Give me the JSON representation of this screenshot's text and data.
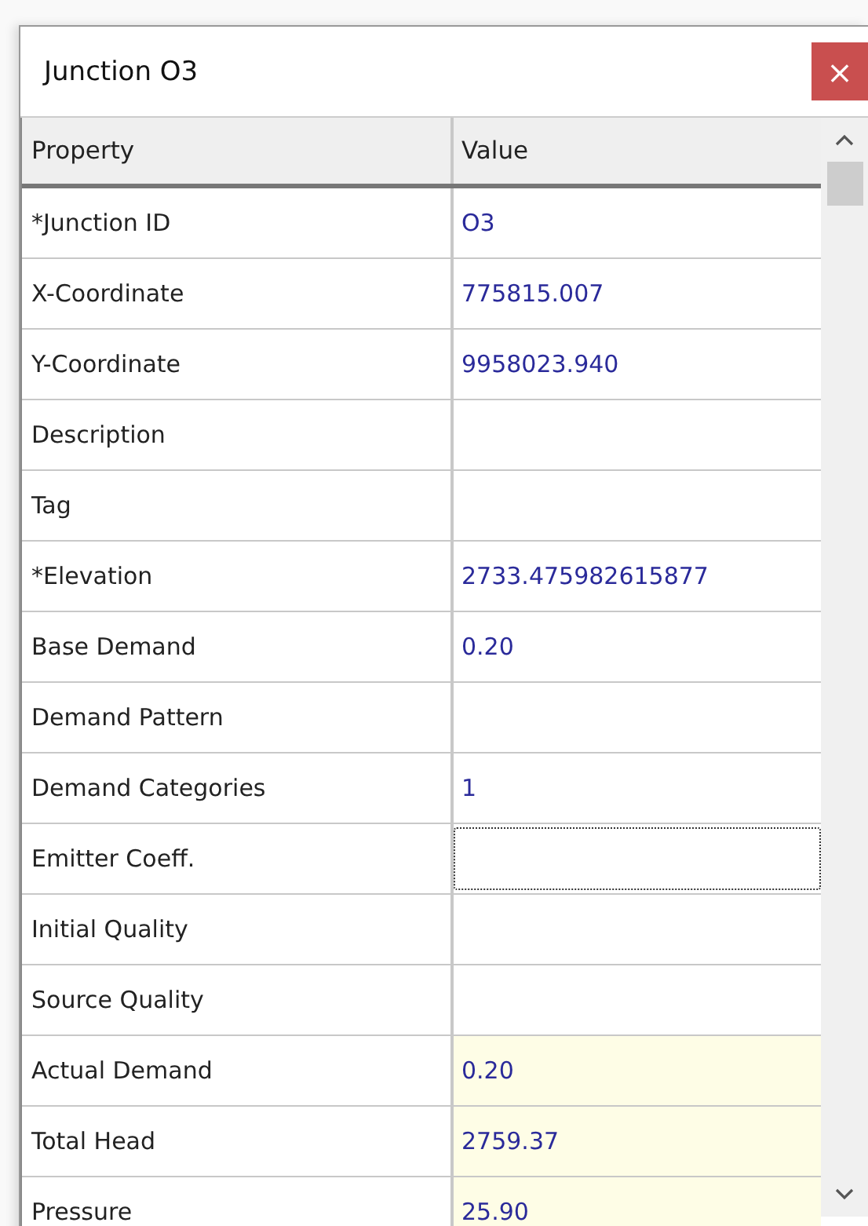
{
  "window": {
    "title": "Junction O3",
    "close": "×"
  },
  "table": {
    "columns": [
      "Property",
      "Value"
    ],
    "rows": [
      {
        "property": "*Junction ID",
        "value": "O3",
        "kind": "input",
        "focused": false
      },
      {
        "property": "X-Coordinate",
        "value": "775815.007",
        "kind": "input",
        "focused": false
      },
      {
        "property": "Y-Coordinate",
        "value": "9958023.940",
        "kind": "input",
        "focused": false
      },
      {
        "property": "Description",
        "kind": "input",
        "focused": false
      },
      {
        "property": "Tag",
        "kind": "input",
        "focused": false
      },
      {
        "property": "*Elevation",
        "value": "2733.475982615877",
        "kind": "input",
        "focused": false
      },
      {
        "property": "Base Demand",
        "value": "0.20",
        "kind": "input",
        "focused": false
      },
      {
        "property": "Demand Pattern",
        "kind": "input",
        "focused": false
      },
      {
        "property": "Demand Categories",
        "value": "1",
        "kind": "input",
        "focused": false
      },
      {
        "property": "Emitter Coeff.",
        "kind": "input",
        "focused": true
      },
      {
        "property": "Initial Quality",
        "kind": "input",
        "focused": false
      },
      {
        "property": "Source Quality",
        "kind": "input",
        "focused": false
      },
      {
        "property": "Actual Demand",
        "value": "0.20",
        "kind": "result",
        "focused": false
      },
      {
        "property": "Total Head",
        "value": "2759.37",
        "kind": "result",
        "focused": false
      },
      {
        "property": "Pressure",
        "value": "25.90",
        "kind": "result",
        "focused": false
      }
    ]
  }
}
